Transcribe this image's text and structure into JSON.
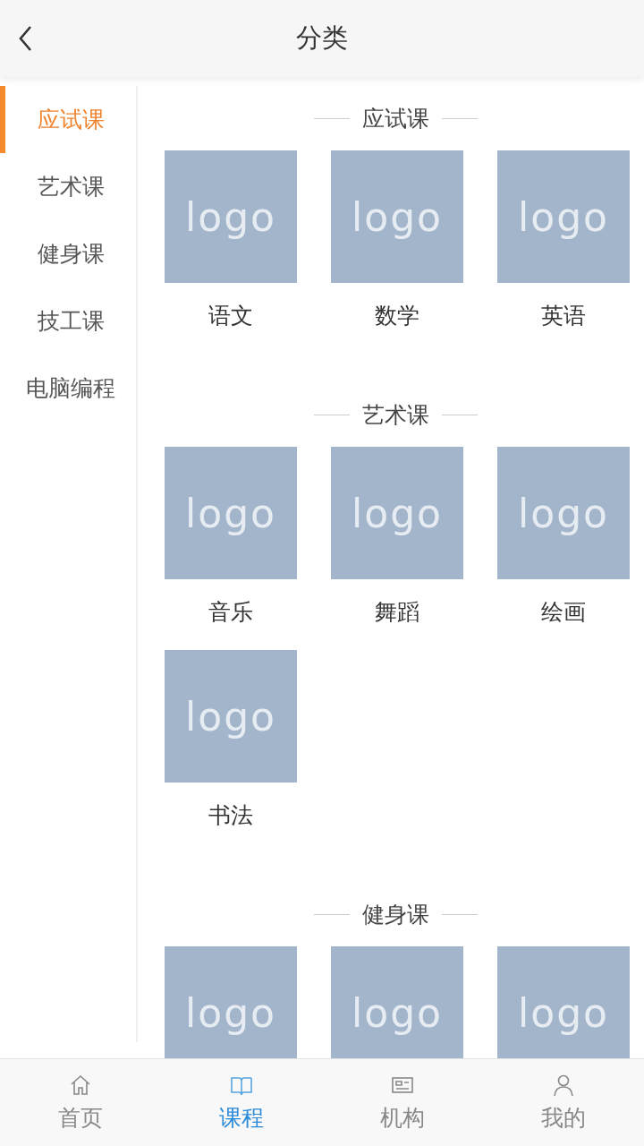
{
  "header": {
    "back_icon": true,
    "title": "分类"
  },
  "sidebar": {
    "items": [
      {
        "label": "应试课",
        "selected": true
      },
      {
        "label": "艺术课",
        "selected": false
      },
      {
        "label": "健身课",
        "selected": false
      },
      {
        "label": "技工课",
        "selected": false
      },
      {
        "label": "电脑编程",
        "selected": false
      }
    ]
  },
  "sections": [
    {
      "title": "应试课",
      "items": [
        {
          "image_text": "logo",
          "label": "语文"
        },
        {
          "image_text": "logo",
          "label": "数学"
        },
        {
          "image_text": "logo",
          "label": "英语"
        }
      ]
    },
    {
      "title": "艺术课",
      "items": [
        {
          "image_text": "logo",
          "label": "音乐"
        },
        {
          "image_text": "logo",
          "label": "舞蹈"
        },
        {
          "image_text": "logo",
          "label": "绘画"
        },
        {
          "image_text": "logo",
          "label": "书法"
        }
      ]
    },
    {
      "title": "健身课",
      "items": [
        {
          "image_text": "logo"
        },
        {
          "image_text": "logo"
        },
        {
          "image_text": "logo"
        }
      ]
    }
  ],
  "tab_bar": [
    {
      "kind": "home",
      "label": "首页",
      "selected": false
    },
    {
      "kind": "book",
      "label": "课程",
      "selected": true
    },
    {
      "kind": "card",
      "label": "机构",
      "selected": false
    },
    {
      "kind": "person",
      "label": "我的",
      "selected": false
    }
  ]
}
